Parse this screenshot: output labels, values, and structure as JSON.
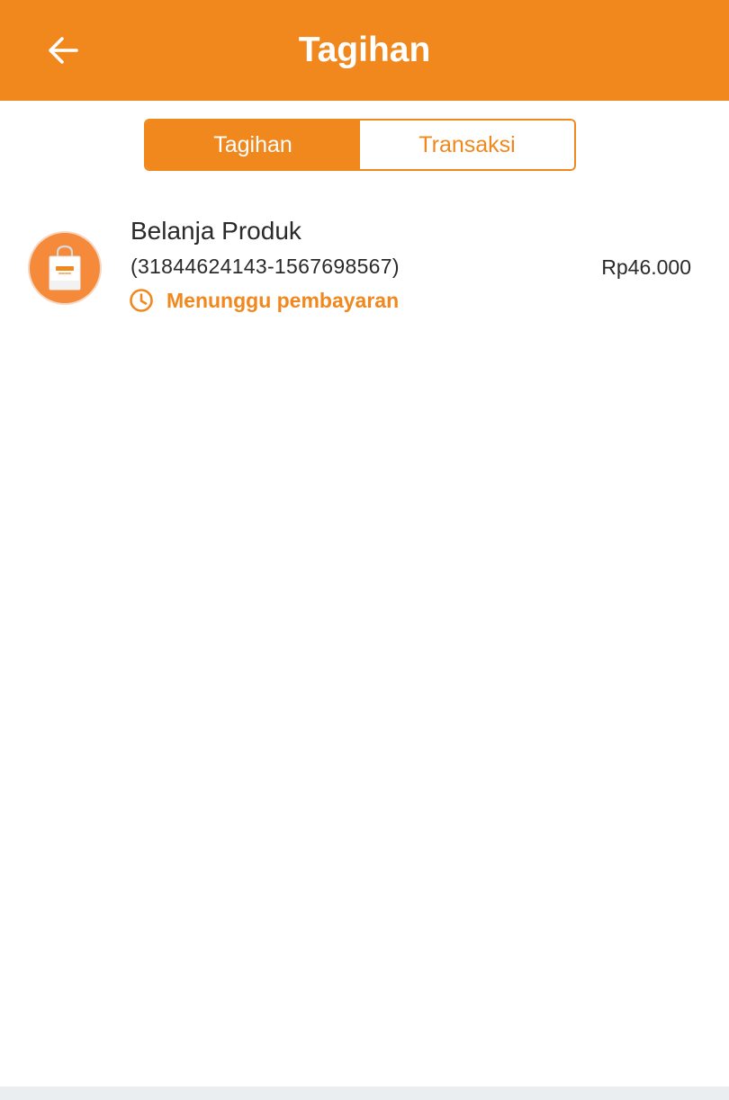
{
  "header": {
    "title": "Tagihan",
    "back_icon": "arrow-left-icon",
    "background_color": "#F0881E"
  },
  "tabs": [
    {
      "label": "Tagihan",
      "active": true
    },
    {
      "label": "Transaksi",
      "active": false
    }
  ],
  "bills": [
    {
      "icon": "shopping-bag-icon",
      "title": "Belanja Produk",
      "id": "(31844624143-1567698567)",
      "status": "Menunggu pembayaran",
      "status_icon": "clock-icon",
      "amount": "Rp46.000"
    }
  ],
  "colors": {
    "accent": "#F0881E",
    "text": "#2a2a2a",
    "background": "#ffffff"
  }
}
